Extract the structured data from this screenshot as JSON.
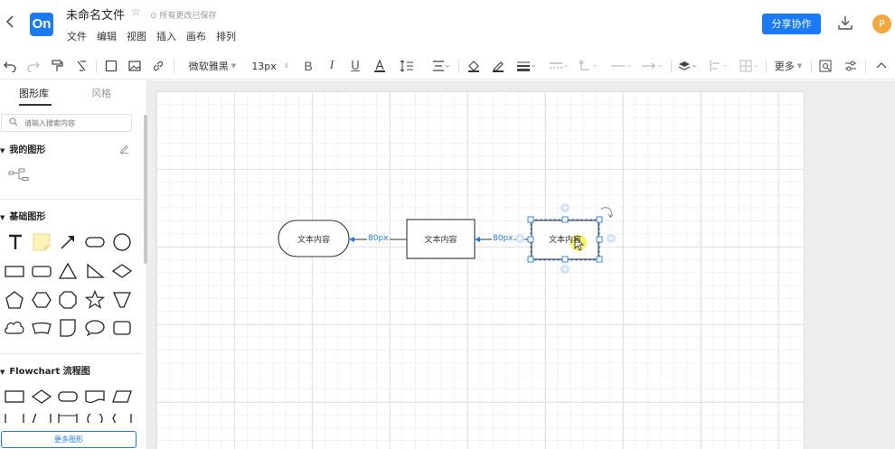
{
  "header": {
    "back_icon": "chevron-left-icon",
    "logo_text": "On",
    "file_title": "未命名文件",
    "save_status": "所有更改已保存",
    "menu": [
      "文件",
      "编辑",
      "视图",
      "插入",
      "画布",
      "排列"
    ],
    "share_label": "分享协作",
    "avatar_letter": "P",
    "colors": {
      "primary": "#1b7bf7",
      "avatar": "#f2a83c"
    }
  },
  "toolbar": {
    "font_family": "微软雅黑",
    "font_size": "13px",
    "more_label": "更多"
  },
  "sidebar": {
    "tabs": [
      "图形库",
      "风格"
    ],
    "active_tab": "图形库",
    "search_placeholder": "请输入搜索内容",
    "sections": {
      "mine": "我的图形",
      "basic": "基础图形",
      "flowchart": "Flowchart 流程图"
    },
    "basic_shapes": [
      "text",
      "note",
      "arrow",
      "rounded-rect",
      "circle",
      "rectangle",
      "rounded-rectangle",
      "triangle",
      "right-triangle",
      "diamond",
      "pentagon",
      "hexagon",
      "octagon",
      "star",
      "inverted-triangle",
      "cloud",
      "trapezoid-curve",
      "shield",
      "ellipse-bubble",
      "rounded-square"
    ],
    "flowchart_shapes": [
      "process",
      "decision",
      "terminator",
      "document",
      "data"
    ],
    "more_shapes_label": "更多图形"
  },
  "diagram": {
    "nodes": [
      {
        "id": "node-1",
        "shape": "rounded",
        "label": "文本内容"
      },
      {
        "id": "node-2",
        "shape": "rectangle",
        "label": "文本内容"
      },
      {
        "id": "node-3",
        "shape": "rectangle",
        "label": "文本内容",
        "selected": true
      }
    ],
    "edges": [
      {
        "from": "node-2",
        "to": "node-1",
        "label": "80px"
      },
      {
        "from": "node-3",
        "to": "node-2",
        "label": "80px"
      }
    ]
  }
}
